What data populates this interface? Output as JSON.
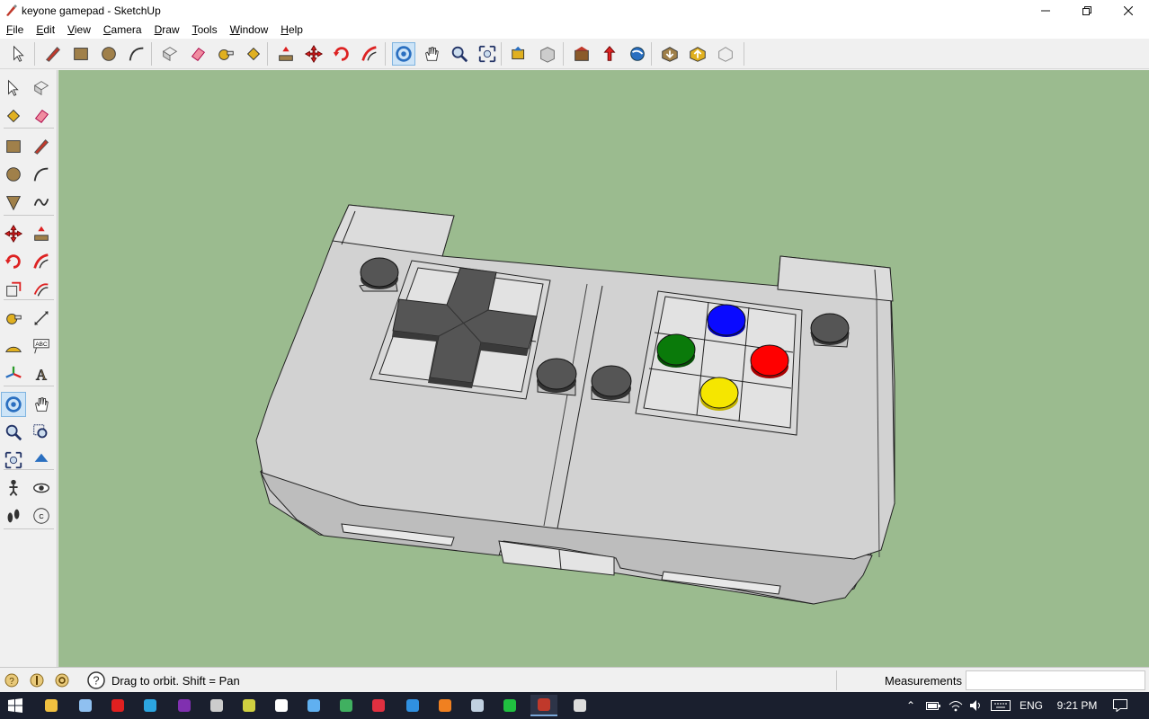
{
  "window": {
    "title": "keyone gamepad - SketchUp"
  },
  "menu": [
    "File",
    "Edit",
    "View",
    "Camera",
    "Draw",
    "Tools",
    "Window",
    "Help"
  ],
  "menu_underline": [
    "F",
    "E",
    "V",
    "C",
    "D",
    "T",
    "W",
    "H"
  ],
  "toolbar": {
    "items": [
      "select-icon",
      "pencil-icon",
      "rectangle-icon",
      "circle-icon",
      "arc-icon",
      "make-component-icon",
      "eraser-icon",
      "tape-measure-icon",
      "paint-bucket-icon",
      "push-pull-icon",
      "move-icon",
      "rotate-icon",
      "follow-me-icon",
      "orbit-icon",
      "pan-icon",
      "zoom-icon",
      "zoom-extents-icon",
      "previous-view-icon",
      "next-view-icon",
      "3d-warehouse-icon",
      "add-location-icon",
      "geo-icon",
      "get-models-icon",
      "share-model-icon",
      "extension-icon"
    ]
  },
  "left_toolbar": {
    "items": [
      "select-icon",
      "make-component-icon",
      "paint-bucket-icon",
      "eraser-icon",
      "rectangle-icon",
      "line-icon",
      "circle-icon",
      "arc-icon",
      "polygon-icon",
      "freehand-icon",
      "move-icon",
      "push-pull-icon",
      "rotate-icon",
      "follow-me-icon",
      "scale-icon",
      "offset-icon",
      "tape-measure-icon",
      "dimension-icon",
      "protractor-icon",
      "text-icon",
      "axes-icon",
      "3d-text-icon",
      "orbit-icon",
      "pan-icon",
      "zoom-icon",
      "zoom-window-icon",
      "zoom-extents-icon",
      "previous-icon",
      "position-camera-icon",
      "look-around-icon",
      "walk-icon",
      "section-plane-icon"
    ]
  },
  "status": {
    "message": "Drag to orbit.  Shift = Pan",
    "measurements_label": "Measurements",
    "measurements_value": ""
  },
  "taskbar": {
    "time": "9:21 PM",
    "language": "ENG",
    "apps": [
      "start-icon",
      "file-explorer-icon",
      "notepad-icon",
      "opera-icon",
      "telegram-icon",
      "onenote-icon",
      "browser-icon",
      "unknown-app-icon",
      "camera-icon",
      "image-viewer-icon",
      "chrome-icon",
      "game-icon",
      "store-icon",
      "blender-icon",
      "steam-icon",
      "line-icon",
      "sketchup-icon",
      "calculator-icon"
    ]
  },
  "model": {
    "name": "keyone gamepad",
    "button_colors": {
      "top": "#0a0aff",
      "left": "#0a7a0a",
      "right": "#ff0000",
      "bottom": "#f5e600",
      "grey": "#505050"
    },
    "background_color": "#9bbb8f"
  }
}
